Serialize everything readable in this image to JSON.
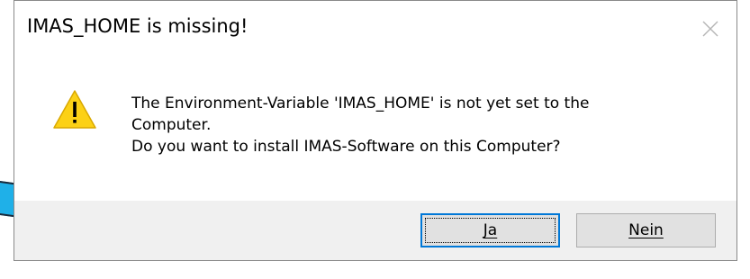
{
  "dialog": {
    "title": "IMAS_HOME is missing!",
    "message_lines": [
      "The Environment-Variable 'IMAS_HOME' is not yet set to the",
      "Computer.",
      "Do you want to install IMAS-Software on this Computer?"
    ],
    "icon": "warning-icon",
    "buttons": {
      "yes_label": "Ja",
      "no_label": "Nein"
    },
    "colors": {
      "button_focus_border": "#0078d7",
      "button_bar_bg": "#f0f0f0",
      "warning_yellow": "#fcd116"
    }
  }
}
